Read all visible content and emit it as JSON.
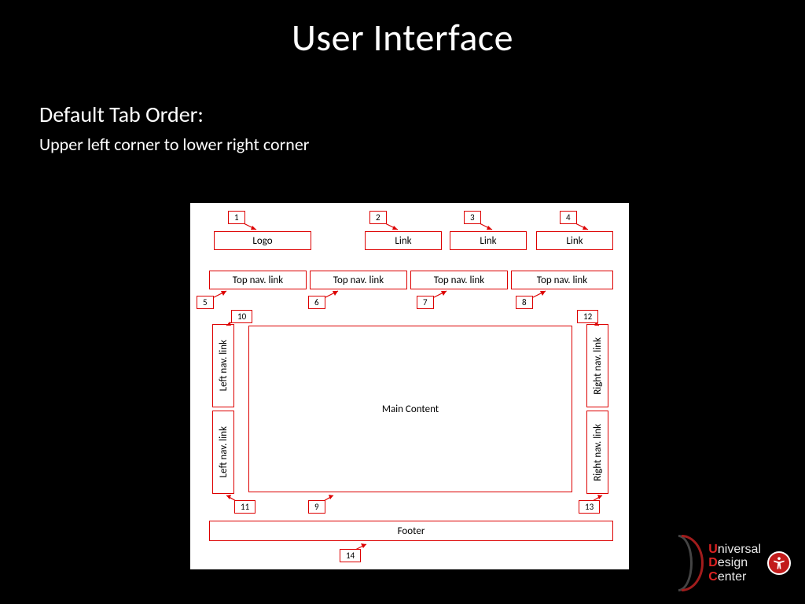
{
  "title": "User Interface",
  "subtitle": "Default Tab Order:",
  "subbody": "Upper left corner to lower right corner",
  "diagram": {
    "logo": "Logo",
    "header_links": [
      "Link",
      "Link",
      "Link"
    ],
    "topnav": [
      "Top nav. link",
      "Top nav. link",
      "Top nav. link",
      "Top nav. link"
    ],
    "leftnav": [
      "Left nav. link",
      "Left nav. link"
    ],
    "rightnav": [
      "Right nav. link",
      "Right nav. link"
    ],
    "main": "Main Content",
    "footer": "Footer",
    "numbers": [
      "1",
      "2",
      "3",
      "4",
      "5",
      "6",
      "7",
      "8",
      "9",
      "10",
      "11",
      "12",
      "13",
      "14"
    ]
  },
  "brand": {
    "line1_initial": "U",
    "line1_rest": "niversal",
    "line2_initial": "D",
    "line2_rest": "esign",
    "line3_initial": "C",
    "line3_rest": "enter"
  }
}
